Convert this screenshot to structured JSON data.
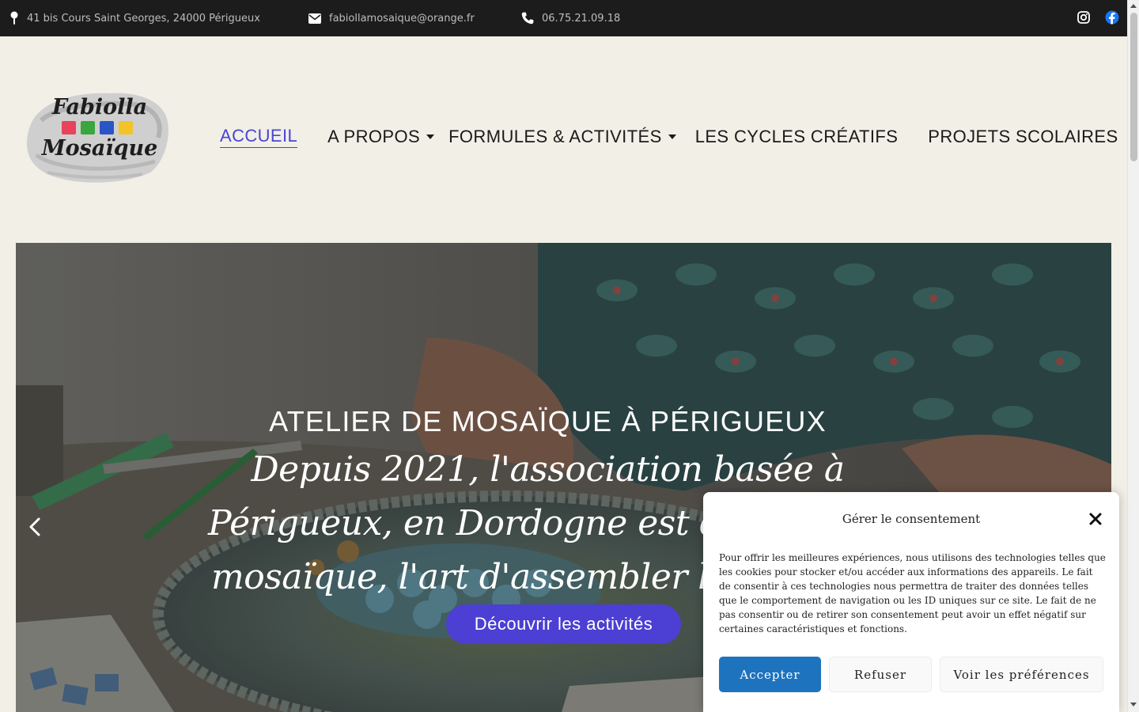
{
  "topbar": {
    "address": "41 bis Cours Saint Georges, 24000 Périgueux",
    "email": "fabiollamosaique@orange.fr",
    "phone": "06.75.21.09.18",
    "icons": [
      "map-pin-icon",
      "envelope-icon",
      "phone-icon",
      "instagram-icon",
      "facebook-icon"
    ]
  },
  "logo": {
    "line1": "Fabiolla",
    "line2": "Mosaïque",
    "tile_colors": [
      "#e8435a",
      "#3aa63f",
      "#2a55c4",
      "#f2c428"
    ]
  },
  "nav": {
    "items": [
      {
        "label": "ACCUEIL",
        "active": true,
        "has_submenu": false
      },
      {
        "label": "A PROPOS",
        "active": false,
        "has_submenu": true
      },
      {
        "label": "FORMULES & ACTIVITÉS",
        "active": false,
        "has_submenu": true
      },
      {
        "label": "LES CYCLES CRÉATIFS",
        "active": false,
        "has_submenu": false
      },
      {
        "label": "PROJETS SCOLAIRES",
        "active": false,
        "has_submenu": false
      }
    ]
  },
  "hero": {
    "title": "ATELIER DE MOSAÏQUE À PÉRIGUEUX",
    "subtitle": "Depuis 2021, l'association basée à Périgueux, en Dordogne est dédiée à la mosaïque, l'art d'assembler la matière.",
    "cta_label": "Découvrir les activités"
  },
  "consent": {
    "title": "Gérer le consentement",
    "text": "Pour offrir les meilleures expériences, nous utilisons des technologies telles que les cookies pour stocker et/ou accéder aux informations des appareils. Le fait de consentir à ces technologies nous permettra de traiter des données telles que le comportement de navigation ou les ID uniques sur ce site. Le fait de ne pas consentir ou de retirer son consentement peut avoir un effet négatif sur certaines caractéristiques et fonctions.",
    "accept_label": "Accepter",
    "refuse_label": "Refuser",
    "prefs_label": "Voir les préférences"
  },
  "colors": {
    "accent": "#4a44d6",
    "cta": "#4c3fd3",
    "accept": "#1e73be",
    "topbar": "#1c1c1c",
    "background": "#f1efe6"
  }
}
